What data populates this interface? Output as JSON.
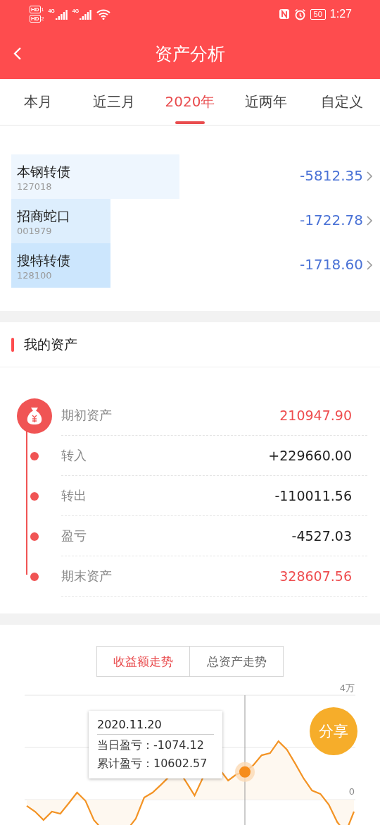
{
  "status_bar": {
    "sims": [
      {
        "hd": "HD",
        "slot": "1",
        "network": "4G"
      },
      {
        "hd": "HD",
        "slot": "2",
        "network": "4G"
      }
    ],
    "battery": "50",
    "time": "1:27"
  },
  "header": {
    "title": "资产分析"
  },
  "tabs": [
    {
      "label": "本月",
      "selected": false
    },
    {
      "label": "近三月",
      "selected": false
    },
    {
      "label": "2020年",
      "selected": true
    },
    {
      "label": "近两年",
      "selected": false
    },
    {
      "label": "自定义",
      "selected": false
    }
  ],
  "loss_top": [
    {
      "name": "本钢转债",
      "code": "127018",
      "amount": "-5812.35",
      "color": "#eef6fe"
    },
    {
      "name": "招商蛇口",
      "code": "001979",
      "amount": "-1722.78",
      "color": "#ddeefd"
    },
    {
      "name": "搜特转债",
      "code": "128100",
      "amount": "-1718.60",
      "color": "#cce6fd"
    }
  ],
  "assets": {
    "title": "我的资产",
    "rows": [
      {
        "label": "期初资产",
        "value": "210947.90",
        "emphasis": true
      },
      {
        "label": "转入",
        "value": "+229660.00",
        "emphasis": false
      },
      {
        "label": "转出",
        "value": "-110011.56",
        "emphasis": false
      },
      {
        "label": "盈亏",
        "value": "-4527.03",
        "emphasis": false
      },
      {
        "label": "期末资产",
        "value": "328607.56",
        "emphasis": true
      }
    ]
  },
  "trend": {
    "segments": [
      {
        "label": "收益额走势",
        "selected": true
      },
      {
        "label": "总资产走势",
        "selected": false
      }
    ],
    "share": "分享",
    "tooltip": {
      "date": "2020.11.20",
      "lines": [
        "当日盈亏：-1074.12",
        "累计盈亏：10602.57"
      ]
    },
    "axis_labels": [
      "4万",
      "0"
    ]
  }
}
